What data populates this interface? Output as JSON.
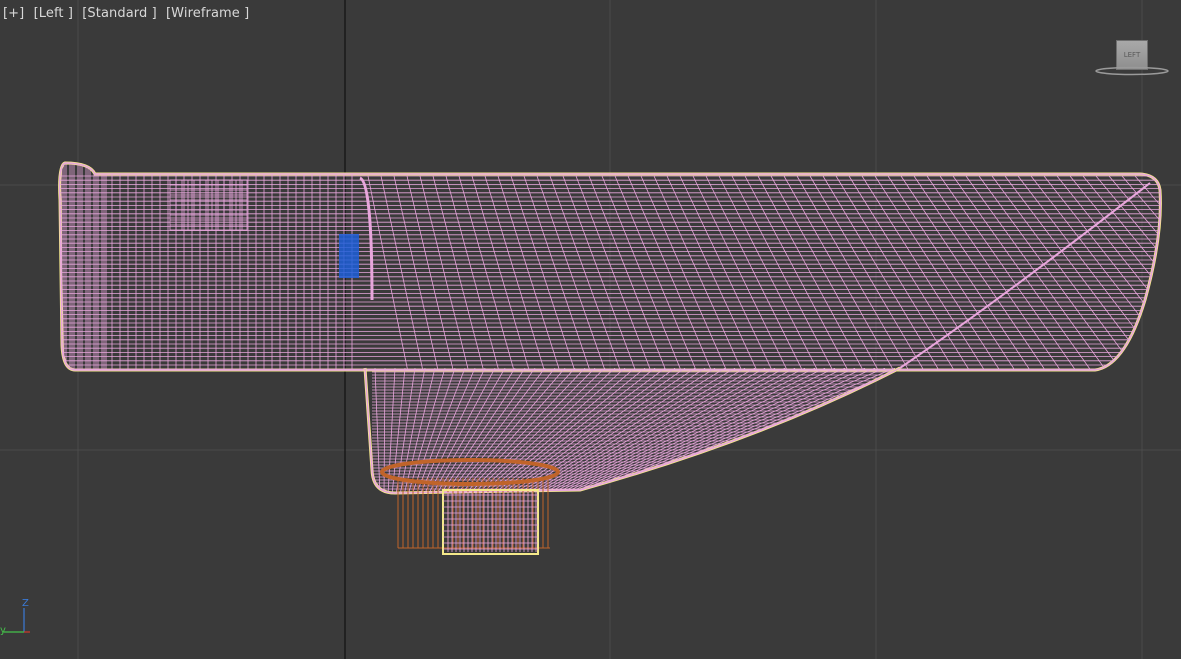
{
  "viewport": {
    "labels": {
      "plus": "[+]",
      "view": "[Left ]",
      "shading_style": "[Standard ]",
      "display_mode": "[Wireframe ]"
    },
    "viewcube_face": "LEFT",
    "axis": {
      "z": "Z",
      "y": "y"
    },
    "colors": {
      "background": "#3a3a3a",
      "grid": "#4b4b4b",
      "grid_axis": "#111111",
      "wireframe_pink": "#e8a6dc",
      "selection_outline": "#f5e98a",
      "wireframe_orange": "#c0642a",
      "blue_patch": "#1f5fd8",
      "axis_z": "#3a7ad6",
      "axis_y": "#45c24a",
      "axis_x": "#d23a2a"
    },
    "icons": [
      "viewcube-icon",
      "axis-tripod-icon"
    ]
  }
}
